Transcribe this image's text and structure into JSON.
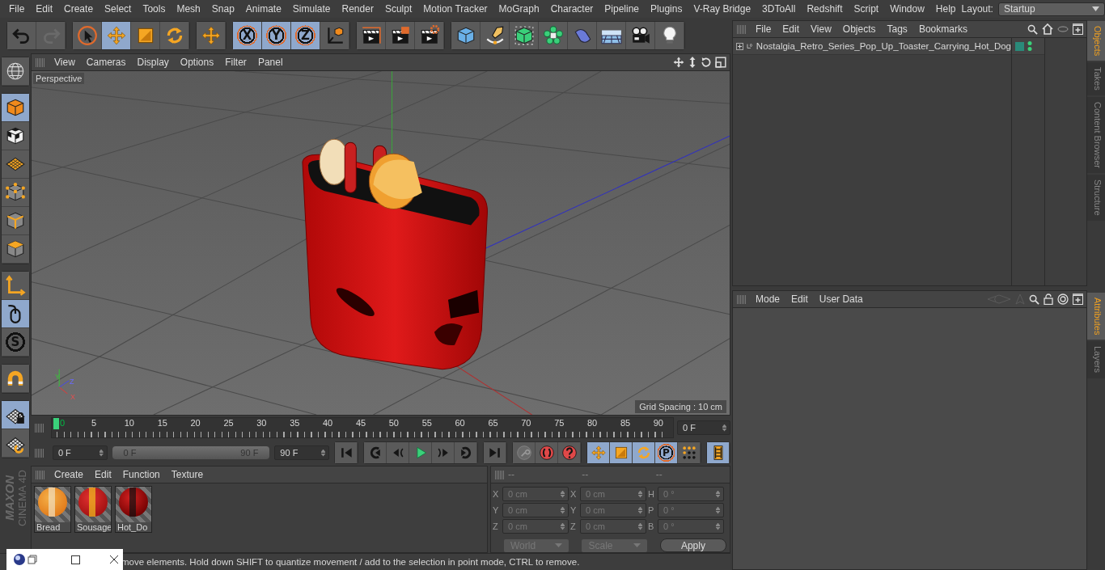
{
  "menu": [
    "File",
    "Edit",
    "Create",
    "Select",
    "Tools",
    "Mesh",
    "Snap",
    "Animate",
    "Simulate",
    "Render",
    "Sculpt",
    "Motion Tracker",
    "MoGraph",
    "Character",
    "Pipeline",
    "Plugins",
    "V-Ray Bridge",
    "3DToAll",
    "Redshift",
    "Script",
    "Window",
    "Help"
  ],
  "layout": {
    "label": "Layout:",
    "value": "Startup"
  },
  "toolbar": [
    {
      "buttons": [
        {
          "kind": "undo",
          "selected": false
        },
        {
          "kind": "redo",
          "selected": false
        }
      ]
    },
    {
      "buttons": [
        {
          "kind": "select",
          "selected": false
        },
        {
          "kind": "move",
          "selected": true
        },
        {
          "kind": "scale",
          "selected": false
        },
        {
          "kind": "rotate",
          "selected": false
        }
      ]
    },
    {
      "buttons": [
        {
          "kind": "move",
          "selected": false
        }
      ]
    },
    {
      "buttons": [
        {
          "kind": "axis",
          "label": "X",
          "selected": true
        },
        {
          "kind": "axis",
          "label": "Y",
          "selected": true
        },
        {
          "kind": "axis",
          "label": "Z",
          "selected": true
        },
        {
          "kind": "coord",
          "selected": false
        }
      ]
    },
    {
      "buttons": [
        {
          "kind": "render",
          "selected": false
        },
        {
          "kind": "renderview",
          "selected": false
        },
        {
          "kind": "rendersettings",
          "selected": false
        }
      ]
    },
    {
      "buttons": [
        {
          "kind": "cube",
          "selected": false
        },
        {
          "kind": "pen",
          "selected": false
        },
        {
          "kind": "subdiv",
          "selected": false
        },
        {
          "kind": "cloner",
          "selected": false
        },
        {
          "kind": "deformer",
          "selected": false
        },
        {
          "kind": "floor",
          "selected": false
        },
        {
          "kind": "camera",
          "selected": false
        },
        {
          "kind": "light",
          "selected": false
        }
      ]
    }
  ],
  "left_toolbar": [
    {
      "buttons": [
        {
          "kind": "viewsphere",
          "selected": false
        }
      ]
    },
    {
      "buttons": [
        {
          "kind": "model",
          "selected": true
        },
        {
          "kind": "texture",
          "selected": false
        },
        {
          "kind": "workplane",
          "selected": false
        },
        {
          "kind": "points",
          "selected": false
        },
        {
          "kind": "edges",
          "selected": false
        },
        {
          "kind": "polygons",
          "selected": false
        }
      ]
    },
    {
      "buttons": [
        {
          "kind": "axiscorner",
          "selected": false
        },
        {
          "kind": "tweak",
          "selected": true
        },
        {
          "kind": "snap",
          "label": "S",
          "selected": false
        }
      ]
    },
    {
      "buttons": [
        {
          "kind": "magnet",
          "selected": false
        }
      ]
    },
    {
      "buttons": [
        {
          "kind": "gridlock",
          "selected": true
        },
        {
          "kind": "gridrotate",
          "selected": false
        }
      ]
    }
  ],
  "logo": {
    "brand": "MAXON",
    "product": "CINEMA 4D"
  },
  "viewport": {
    "menu": [
      "View",
      "Cameras",
      "Display",
      "Options",
      "Filter",
      "Panel"
    ],
    "camera": "Perspective",
    "grid_spacing": "Grid Spacing : 10 cm",
    "gizmo": {
      "y": "Y",
      "z": "Z",
      "x": "X"
    }
  },
  "timeline": {
    "ticks": [
      {
        "label": "0",
        "selected": true
      },
      {
        "label": "5",
        "selected": false
      },
      {
        "label": "10",
        "selected": false
      },
      {
        "label": "15",
        "selected": false
      },
      {
        "label": "20",
        "selected": false
      },
      {
        "label": "25",
        "selected": false
      },
      {
        "label": "30",
        "selected": false
      },
      {
        "label": "35",
        "selected": false
      },
      {
        "label": "40",
        "selected": false
      },
      {
        "label": "45",
        "selected": false
      },
      {
        "label": "50",
        "selected": false
      },
      {
        "label": "55",
        "selected": false
      },
      {
        "label": "60",
        "selected": false
      },
      {
        "label": "65",
        "selected": false
      },
      {
        "label": "70",
        "selected": false
      },
      {
        "label": "75",
        "selected": false
      },
      {
        "label": "80",
        "selected": false
      },
      {
        "label": "85",
        "selected": false
      },
      {
        "label": "90",
        "selected": false
      }
    ],
    "current_frame": "0 F"
  },
  "playback": {
    "start": "0 F",
    "range": {
      "start": "0 F",
      "end": "90 F",
      "level": 1
    },
    "end": "90 F",
    "groups": [
      {
        "buttons": [
          {
            "kind": "first",
            "selected": false
          }
        ]
      },
      {
        "buttons": [
          {
            "kind": "prevkey",
            "selected": false
          },
          {
            "kind": "prevframe",
            "selected": false
          },
          {
            "kind": "play",
            "selected": false
          },
          {
            "kind": "nextframe",
            "selected": false
          },
          {
            "kind": "nextkey",
            "selected": false
          }
        ]
      },
      {
        "buttons": [
          {
            "kind": "last",
            "selected": false
          }
        ]
      },
      {
        "buttons": [
          {
            "kind": "keyrec",
            "selected": false
          },
          {
            "kind": "autokey",
            "selected": false
          },
          {
            "kind": "keyhelp",
            "selected": false
          }
        ]
      },
      {
        "buttons": [
          {
            "kind": "move",
            "selected": true
          },
          {
            "kind": "scale",
            "selected": true
          },
          {
            "kind": "rotate",
            "selected": true
          },
          {
            "kind": "param",
            "label": "P",
            "selected": true
          },
          {
            "kind": "dots",
            "selected": false
          }
        ]
      },
      {
        "buttons": [
          {
            "kind": "film",
            "selected": true
          }
        ]
      }
    ]
  },
  "materials": {
    "menu": [
      "Create",
      "Edit",
      "Function",
      "Texture"
    ],
    "items": [
      {
        "name": "Bread",
        "kind": "bread"
      },
      {
        "name": "Sousage",
        "kind": "sausage"
      },
      {
        "name": "Hot_Do",
        "kind": "hotdog"
      }
    ]
  },
  "coordinates": {
    "headers": [
      "--",
      "--",
      "--"
    ],
    "columns": [
      [
        {
          "axis": "X",
          "value": "0 cm"
        },
        {
          "axis": "Y",
          "value": "0 cm"
        },
        {
          "axis": "Z",
          "value": "0 cm"
        }
      ],
      [
        {
          "axis": "X",
          "value": "0 cm"
        },
        {
          "axis": "Y",
          "value": "0 cm"
        },
        {
          "axis": "Z",
          "value": "0 cm"
        }
      ],
      [
        {
          "axis": "H",
          "value": "0 °"
        },
        {
          "axis": "P",
          "value": "0 °"
        },
        {
          "axis": "B",
          "value": "0 °"
        }
      ]
    ],
    "mode": "World",
    "size": "Scale",
    "apply": "Apply",
    "disabled": true
  },
  "status_bar": "move elements. Hold down SHIFT to quantize movement / add to the selection in point mode, CTRL to remove.",
  "objects": {
    "menu": [
      "File",
      "Edit",
      "View",
      "Objects",
      "Tags",
      "Bookmarks"
    ],
    "items": [
      {
        "name": "Nostalgia_Retro_Series_Pop_Up_Toaster_Carrying_Hot_Dog",
        "expanded": false
      }
    ]
  },
  "attributes": {
    "menu": [
      "Mode",
      "Edit",
      "User Data"
    ]
  },
  "side_tabs_top": [
    {
      "label": "Objects",
      "selected": true
    },
    {
      "label": "Takes",
      "selected": false
    },
    {
      "label": "Content Browser",
      "selected": false
    },
    {
      "label": "Structure",
      "selected": false
    }
  ],
  "side_tabs_bottom": [
    {
      "label": "Attributes",
      "selected": true
    },
    {
      "label": "Layers",
      "selected": false
    }
  ]
}
